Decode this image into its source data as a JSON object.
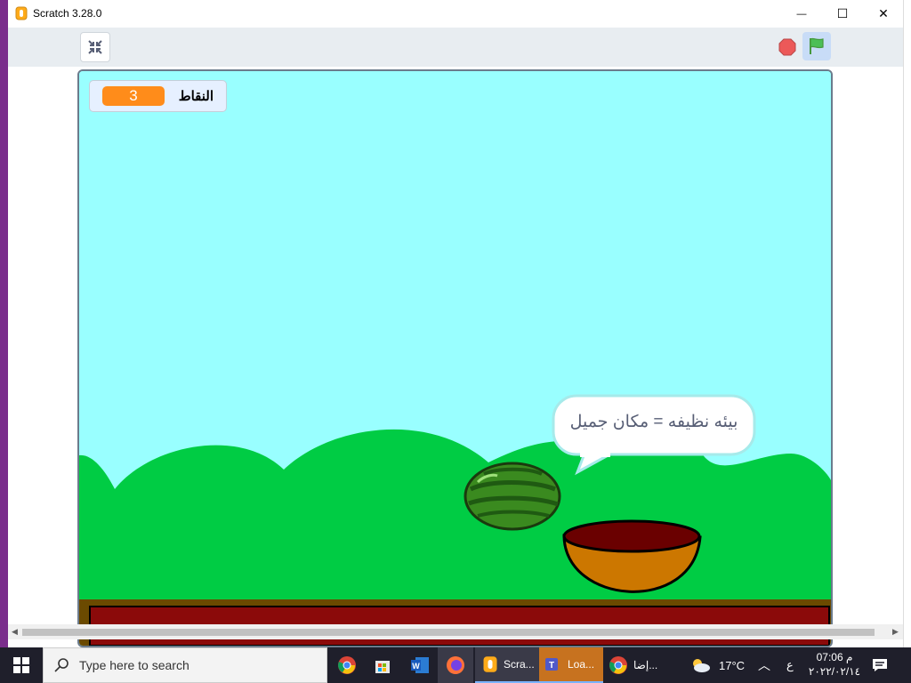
{
  "window": {
    "title": "Scratch 3.28.0",
    "minimize_glyph": "—",
    "maximize_glyph": "☐",
    "close_glyph": "✕"
  },
  "toolbar": {
    "fullscreen_icon": "unfullscreen-icon",
    "stop_icon": "stop-icon",
    "flag_icon": "green-flag-icon"
  },
  "stage": {
    "variable_label": "النقاط",
    "variable_value": "3",
    "speech_bubble": "بيئه نظيفه = مكان جميل",
    "colors": {
      "sky": "#99ffff",
      "hills": "#00cc44",
      "ground_dark": "#8b0a0a",
      "bowl": "#cc7700",
      "watermelon": "#3a8a1f"
    }
  },
  "taskbar": {
    "search_placeholder": "Type here to search",
    "apps": [
      {
        "name": "chrome",
        "label": ""
      },
      {
        "name": "store",
        "label": ""
      },
      {
        "name": "word",
        "label": ""
      },
      {
        "name": "firefox",
        "label": ""
      },
      {
        "name": "scratch",
        "label": "Scra..."
      },
      {
        "name": "teams",
        "label": "Loa..."
      },
      {
        "name": "chrome-2",
        "label": "إضا..."
      }
    ],
    "weather": "17°C",
    "language": "ع",
    "time": "07:06 م",
    "date": "٢٠٢٢/٠٢/١٤"
  }
}
